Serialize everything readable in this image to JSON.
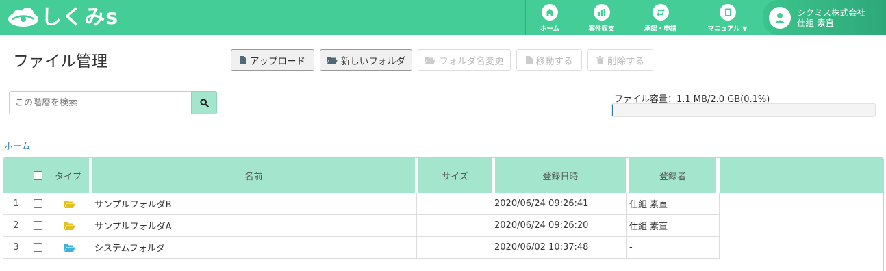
{
  "header": {
    "logo_text": "しくみs",
    "nav": [
      {
        "label": "ホーム",
        "icon": "home-icon"
      },
      {
        "label": "案件収支",
        "icon": "chart-icon"
      },
      {
        "label": "承認・申請",
        "icon": "repeat-icon"
      },
      {
        "label": "マニュアル ▼",
        "icon": "book-icon"
      }
    ],
    "user": {
      "company": "シクミス株式会社",
      "name": "仕組 素直"
    }
  },
  "page": {
    "title": "ファイル管理"
  },
  "toolbar": {
    "upload": "アップロード",
    "new_folder": "新しいフォルダ",
    "rename_folder": "フォルダ名変更",
    "move": "移動する",
    "delete": "削除する"
  },
  "search": {
    "placeholder": "この階層を検索"
  },
  "capacity": {
    "label": "ファイル容量：1.1 MB/2.0 GB(0.1%)",
    "used_percent": 0.1
  },
  "breadcrumb": {
    "home": "ホーム"
  },
  "table": {
    "headers": {
      "type": "タイプ",
      "name": "名前",
      "size": "サイズ",
      "date": "登録日時",
      "registrant": "登録者"
    },
    "rows": [
      {
        "num": "1",
        "name": "サンプルフォルダB",
        "size": "",
        "date": "2020/06/24 09:26:41",
        "registrant": "仕組 素直",
        "folder_color": "#e2c21e"
      },
      {
        "num": "2",
        "name": "サンプルフォルダA",
        "size": "",
        "date": "2020/06/24 09:26:20",
        "registrant": "仕組 素直",
        "folder_color": "#e2c21e"
      },
      {
        "num": "3",
        "name": "システムフォルダ",
        "size": "",
        "date": "2020/06/02 10:37:48",
        "registrant": "-",
        "folder_color": "#3fb4d8"
      }
    ]
  },
  "colors": {
    "brand": "#45cd98",
    "header_row": "#a4e5cd",
    "link": "#337ab7"
  }
}
